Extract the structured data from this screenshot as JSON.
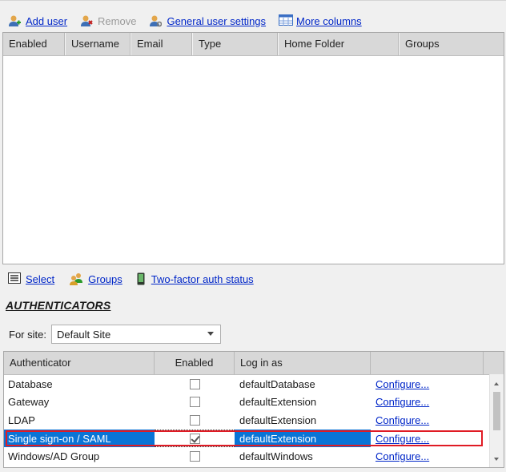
{
  "toolbar": {
    "add_user": "Add user",
    "remove": "Remove",
    "general_settings": "General user settings",
    "more_columns": "More columns"
  },
  "users_table": {
    "columns": [
      "Enabled",
      "Username",
      "Email",
      "Type",
      "Home Folder",
      "Groups"
    ]
  },
  "actions": {
    "select": "Select",
    "groups": "Groups",
    "two_factor": "Two-factor auth status"
  },
  "authenticators": {
    "title": "AUTHENTICATORS",
    "for_site_label": "For site:",
    "site_value": "Default Site",
    "columns": [
      "Authenticator",
      "Enabled",
      "Log in as",
      ""
    ],
    "rows": [
      {
        "name": "Database",
        "enabled": false,
        "login": "defaultDatabase",
        "action": "Configure..."
      },
      {
        "name": "Gateway",
        "enabled": false,
        "login": "defaultExtension",
        "action": "Configure..."
      },
      {
        "name": "LDAP",
        "enabled": false,
        "login": "defaultExtension",
        "action": "Configure..."
      },
      {
        "name": "Single sign-on / SAML",
        "enabled": true,
        "login": "defaultExtension",
        "action": "Configure..."
      },
      {
        "name": "Windows/AD Group",
        "enabled": false,
        "login": "defaultWindows",
        "action": "Configure..."
      }
    ],
    "selected_row": 3
  },
  "colors": {
    "link": "#0026c8",
    "selection": "#0a74d6",
    "highlight_outline": "#e01b24"
  }
}
